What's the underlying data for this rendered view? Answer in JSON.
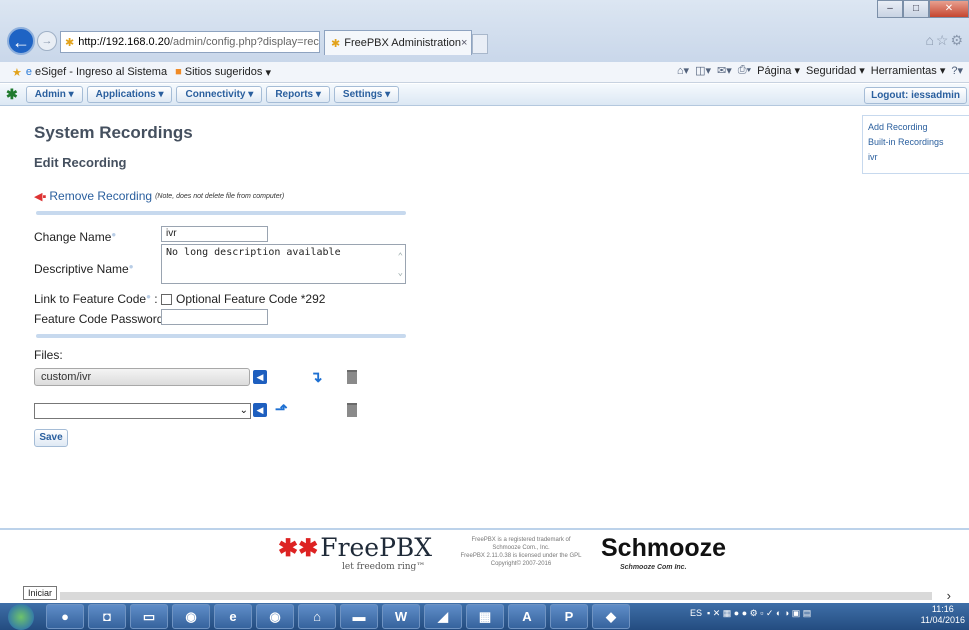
{
  "browser": {
    "url_host": "http://192.168.0.20",
    "url_path": "/admin/config.php?display=record",
    "tab_title": "FreePBX Administration",
    "favorites": [
      "eSigef - Ingreso al Sistema",
      "Sitios sugeridos"
    ],
    "command_bar": [
      "Página",
      "Seguridad",
      "Herramientas"
    ]
  },
  "nav": {
    "menus": [
      "Admin",
      "Applications",
      "Connectivity",
      "Reports",
      "Settings"
    ],
    "logout": "Logout: iessadmin"
  },
  "page": {
    "title": "System Recordings",
    "subtitle": "Edit Recording",
    "remove_label": "Remove Recording",
    "remove_note": "(Note, does not delete file from computer)",
    "change_name_label": "Change Name",
    "change_name_value": "ivr",
    "descriptive_name_label": "Descriptive Name",
    "descriptive_name_value": "No long description available",
    "feature_code_label": "Link to Feature Code",
    "feature_code_option": "Optional Feature Code *292",
    "feature_password_label": "Feature Code Password",
    "files_label": "Files:",
    "file_1": "custom/ivr",
    "save_label": "Save"
  },
  "rightnav": {
    "items": [
      "Add Recording",
      "Built-in Recordings",
      "ivr"
    ]
  },
  "footer": {
    "freepbx": "FreePBX",
    "tagline": "let freedom ring™",
    "legal_1": "FreePBX is a registered trademark of",
    "legal_2": "Schmooze Com., Inc.",
    "legal_3": "FreePBX 2.11.0.38 is licensed under the GPL",
    "legal_4": "Copyright© 2007-2016",
    "schmooze": "Schmooze",
    "schmooze_sub": "Schmooze Com Inc."
  },
  "status": {
    "tooltip": "Iniciar",
    "time": "11:16",
    "date": "11/04/2016",
    "lang": "ES"
  },
  "taskbar": {
    "apps": [
      "firefox-icon",
      "outlook-icon",
      "folder-icon",
      "chrome-icon",
      "ie-icon",
      "chrome-icon",
      "network-icon",
      "app-icon",
      "word-icon",
      "app-icon",
      "app-icon",
      "acrobat-icon",
      "powerpoint-icon",
      "app-icon"
    ]
  }
}
